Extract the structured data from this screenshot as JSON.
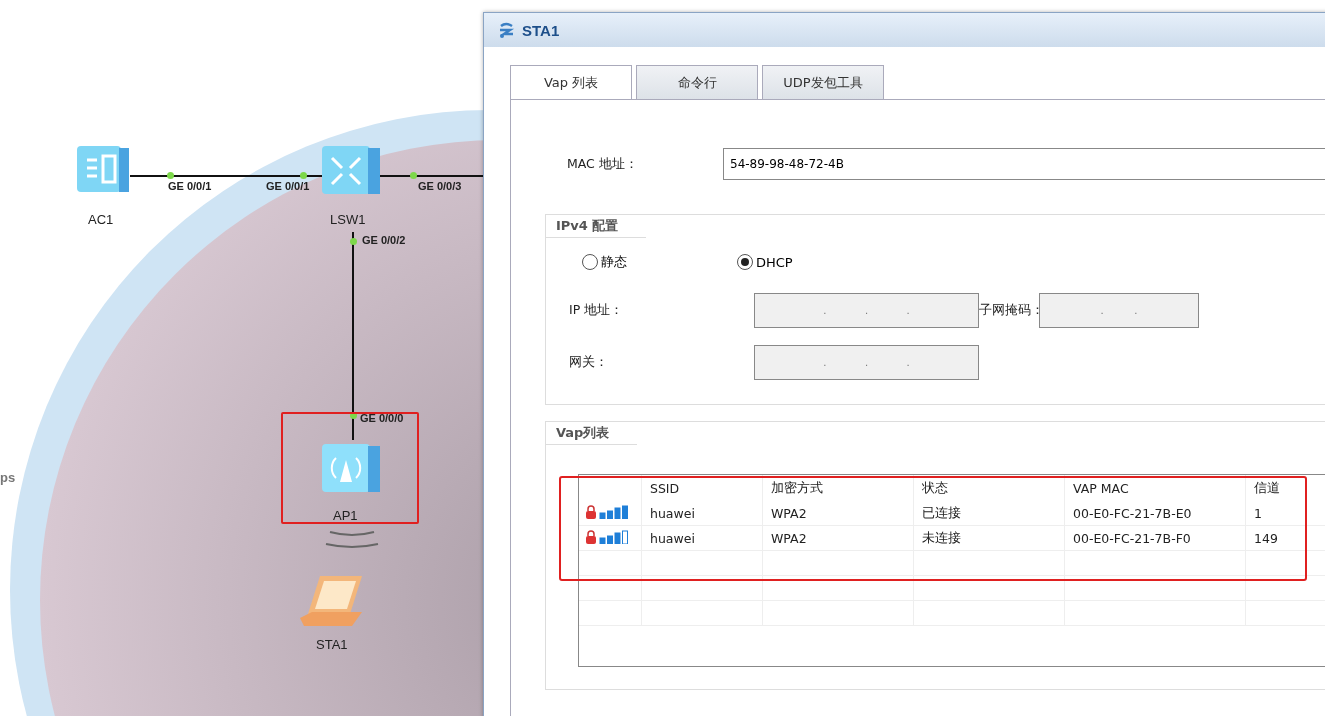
{
  "canvas": {
    "edge_text": "ps",
    "devices": [
      {
        "kind": "ac",
        "label": "AC1",
        "selected": false
      },
      {
        "kind": "switch",
        "label": "LSW1",
        "selected": false
      },
      {
        "kind": "ap",
        "label": "AP1",
        "selected": true
      },
      {
        "kind": "station",
        "label": "STA1",
        "selected": false
      }
    ],
    "ports": [
      "GE 0/0/1",
      "GE 0/0/1",
      "GE 0/0/3",
      "GE 0/0/2",
      "GE 0/0/0"
    ]
  },
  "dialog": {
    "title": "STA1",
    "tabs": [
      {
        "label": "Vap 列表",
        "selected": true
      },
      {
        "label": "命令行",
        "selected": false
      },
      {
        "label": "UDP发包工具",
        "selected": false
      }
    ],
    "mac": {
      "label": "MAC 地址：",
      "value": "54-89-98-48-72-4B"
    },
    "ipv4": {
      "title": "IPv4 配置",
      "modes": [
        {
          "label": "静态",
          "selected": false
        },
        {
          "label": "DHCP",
          "selected": true
        }
      ],
      "fields": [
        {
          "label": "IP 地址：",
          "dots": [
            ".",
            ".",
            "."
          ]
        },
        {
          "label": "子网掩码：",
          "dots": [
            ".",
            "."
          ]
        },
        {
          "label": "网关：",
          "dots": [
            ".",
            ".",
            "."
          ]
        }
      ]
    },
    "vap": {
      "title": "Vap列表",
      "highlighted": true,
      "columns": [
        "SSID",
        "加密方式",
        "状态",
        "VAP MAC",
        "信道"
      ],
      "rows": [
        {
          "kind": "full",
          "cells": [
            "huawei",
            "WPA2",
            "已连接",
            "00-E0-FC-21-7B-E0",
            "1"
          ]
        },
        {
          "kind": "partial",
          "cells": [
            "huawei",
            "WPA2",
            "未连接",
            "00-E0-FC-21-7B-F0",
            "149"
          ]
        }
      ]
    }
  }
}
